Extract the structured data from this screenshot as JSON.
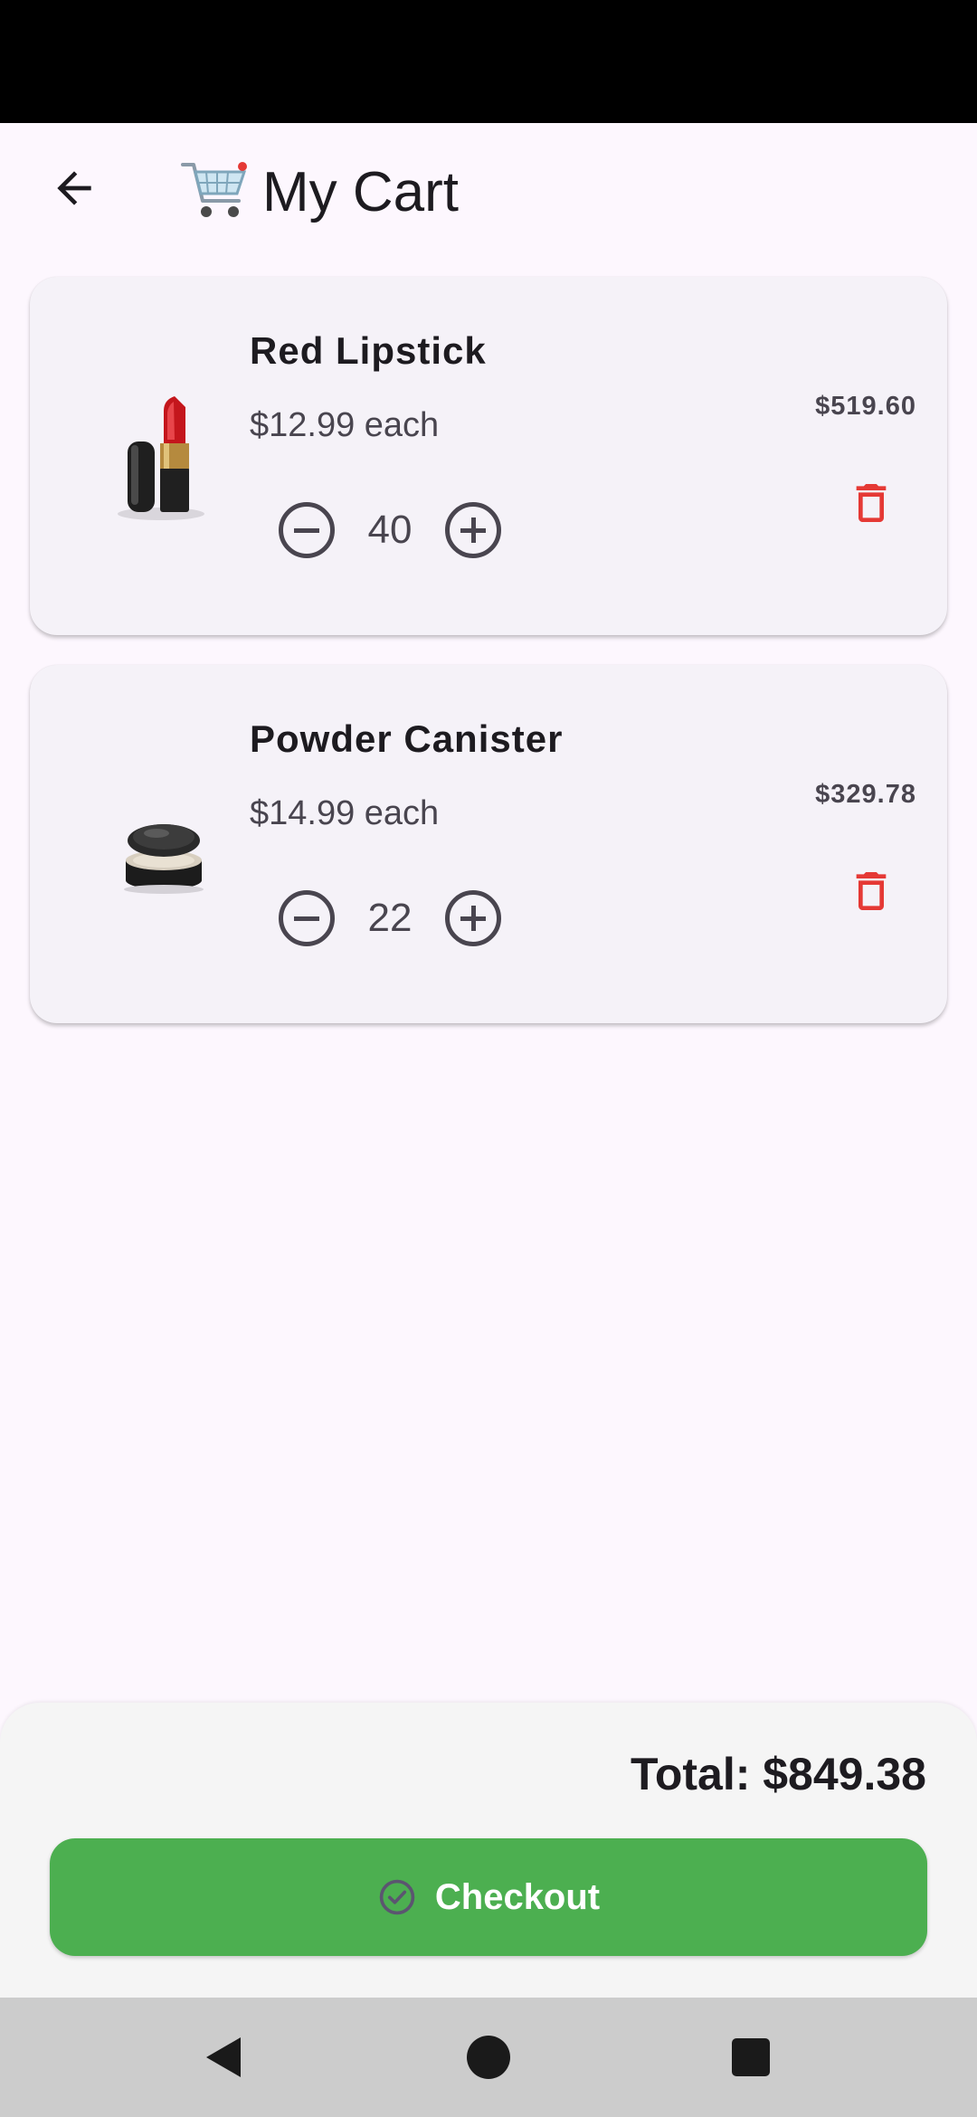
{
  "app_bar": {
    "title": "My Cart",
    "back_icon": "arrow-back-icon",
    "title_icon": "shopping-cart-icon"
  },
  "cart": {
    "items": [
      {
        "name": "Red Lipstick",
        "unit_price": "$12.99 each",
        "quantity": "40",
        "line_total": "$519.60",
        "image_icon": "lipstick-icon"
      },
      {
        "name": "Powder Canister",
        "unit_price": "$14.99 each",
        "quantity": "22",
        "line_total": "$329.78",
        "image_icon": "powder-compact-icon"
      }
    ]
  },
  "summary": {
    "total": "Total: $849.38",
    "checkout_label": "Checkout"
  },
  "colors": {
    "background": "#fdf7fe",
    "card": "#f5f2f8",
    "accent_green": "#4caf50",
    "delete_red": "#e53935"
  }
}
